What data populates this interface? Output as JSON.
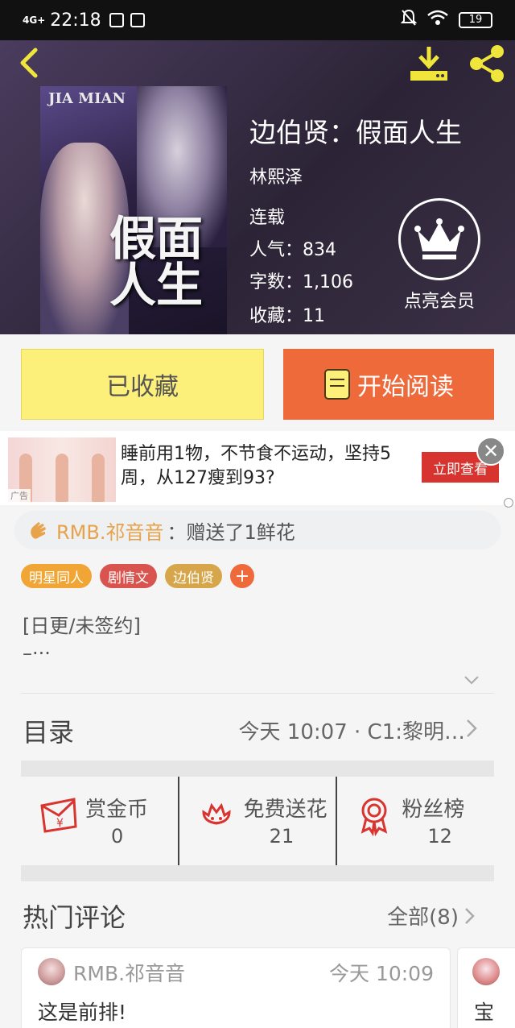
{
  "status_bar": {
    "network": "4G+",
    "time": "22:18",
    "battery": "19"
  },
  "book": {
    "cover_en": "JIA MIAN",
    "cover_title": "假面人生",
    "title": "边伯贤：假面人生",
    "author": "林熙泽",
    "status": "连载",
    "popularity_label": "人气：",
    "popularity": "834",
    "words_label": "字数：",
    "words": "1,106",
    "favorites_label": "收藏：",
    "favorites": "11"
  },
  "vip": {
    "label": "点亮会员"
  },
  "actions": {
    "favorited_label": "已收藏",
    "read_label": "开始阅读"
  },
  "ad": {
    "tag": "广告",
    "text": "睡前用1物，不节食不运动，坚持5周，从127瘦到93?",
    "cta": "立即查看"
  },
  "gift": {
    "user": "RMB.祁音音",
    "text": "：赠送了1鲜花"
  },
  "tags": [
    {
      "label": "明星同人",
      "color": "#f0a534"
    },
    {
      "label": "剧情文",
      "color": "#d9534f"
    },
    {
      "label": "边伯贤",
      "color": "#d7a64a"
    }
  ],
  "tag_add": "+",
  "description": {
    "line1": "[日更/未签约]",
    "line2": "–···"
  },
  "toc": {
    "title": "目录",
    "latest": "今天 10:07 · C1:黎明…"
  },
  "stats": [
    {
      "icon": "red-envelope-icon",
      "label": "赏金币",
      "value": "0"
    },
    {
      "icon": "flower-icon",
      "label": "免费送花",
      "value": "21"
    },
    {
      "icon": "medal-icon",
      "label": "粉丝榜",
      "value": "12"
    }
  ],
  "comments": {
    "title": "热门评论",
    "all_label": "全部(8)",
    "items": [
      {
        "user": "RMB.祁音音",
        "time": "今天 10:09",
        "text": "这是前排!"
      },
      {
        "text": "宝"
      }
    ]
  },
  "colors": {
    "accent_orange": "#ee6a3a",
    "fav_yellow": "#fdf07a",
    "ad_red": "#d8342f",
    "gift_orange": "#e7a24a"
  }
}
